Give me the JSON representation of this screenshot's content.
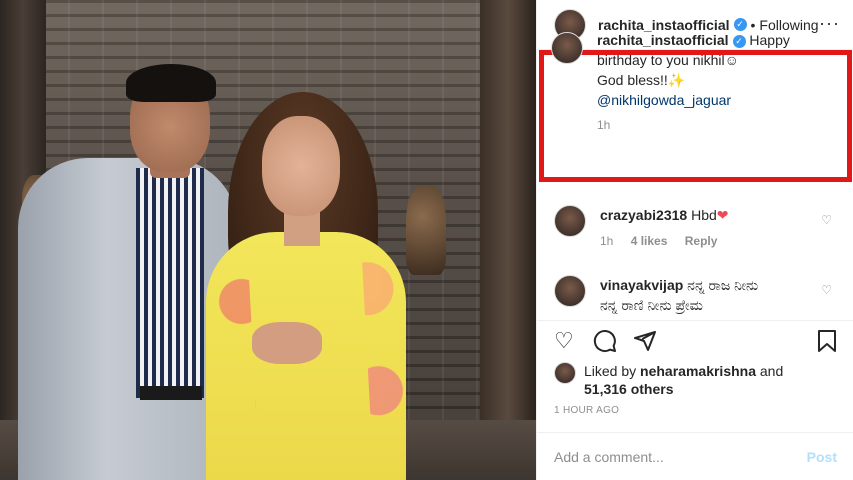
{
  "header": {
    "username": "rachita_instaofficial",
    "separator": "•",
    "follow_label": "Following",
    "more_label": "···"
  },
  "caption": {
    "username": "rachita_instaofficial",
    "line1": "Happy birthday to you nikhil",
    "emoji1": "☺",
    "line2": "God bless!!",
    "emoji2": "✨",
    "mention": "@nikhilgowda_jaguar",
    "time": "1h"
  },
  "comments": [
    {
      "username": "crazyabi2318",
      "text": "Hbd",
      "emoji": "❤",
      "time": "1h",
      "likes": "4 likes",
      "reply": "Reply"
    },
    {
      "username": "vinayakvijap",
      "text": "ನನ್ನ ರಾಜ ನೀನು",
      "text2": "ನನ್ನ ರಾಣಿ ನೀನು ಪ್ರೇಮ"
    }
  ],
  "likes": {
    "prefix": "Liked by",
    "user": "neharamakrishna",
    "connector": "and",
    "count": "51,316 others"
  },
  "time_ago": "1 HOUR AGO",
  "add_comment": {
    "placeholder": "Add a comment...",
    "post_label": "Post"
  },
  "colors": {
    "highlight_border": "#e01818",
    "verified": "#3897f0",
    "link": "#00376b",
    "post_disabled": "#b2dffc"
  }
}
